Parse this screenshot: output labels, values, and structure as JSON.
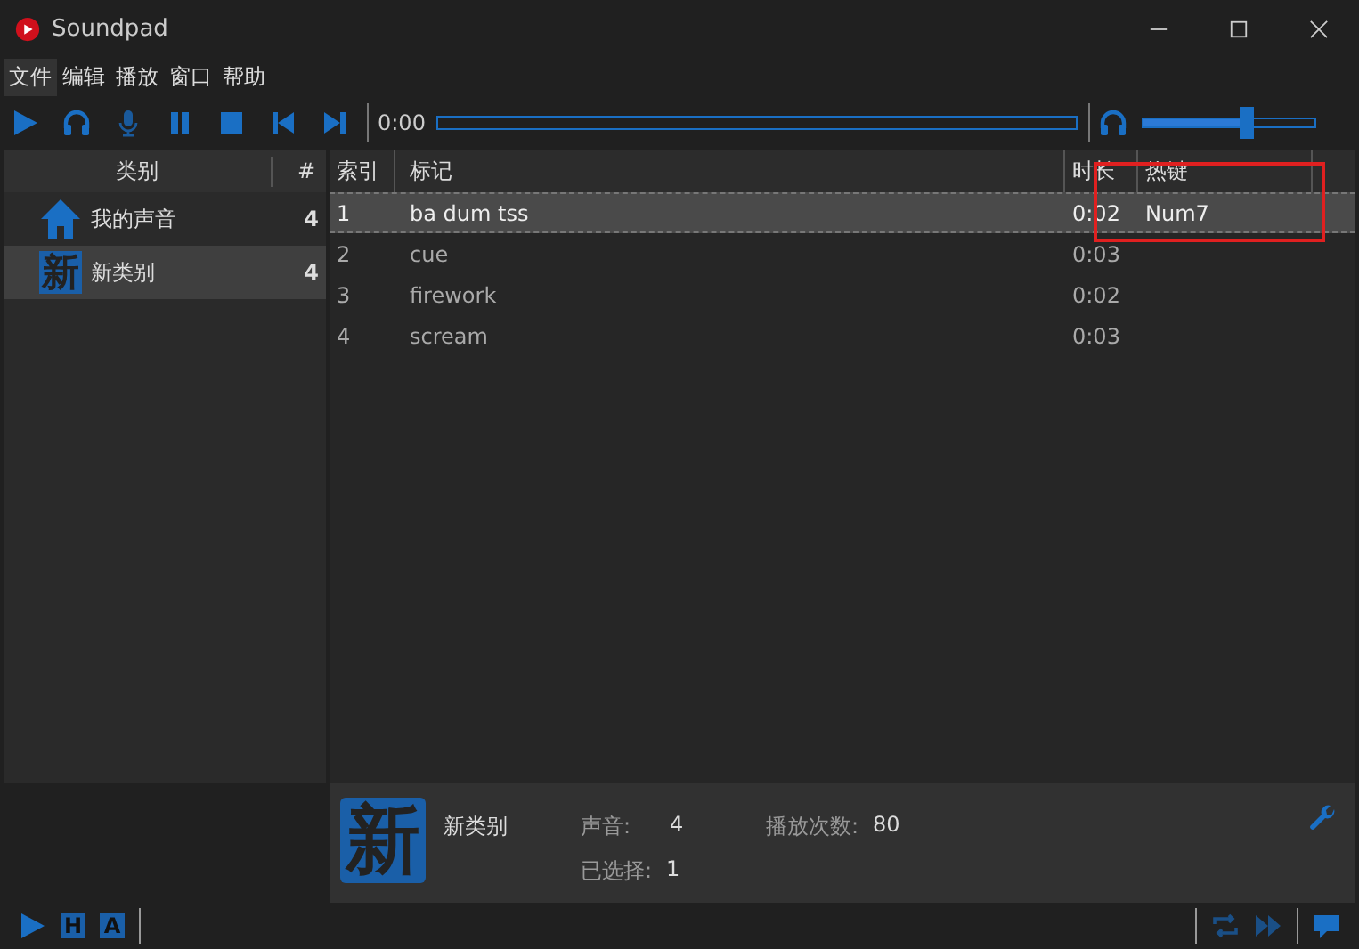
{
  "window": {
    "title": "Soundpad"
  },
  "menu": [
    {
      "label": "文件",
      "selected": true
    },
    {
      "label": "编辑",
      "selected": false
    },
    {
      "label": "播放",
      "selected": false
    },
    {
      "label": "窗口",
      "selected": false
    },
    {
      "label": "帮助",
      "selected": false
    }
  ],
  "toolbar": {
    "time": "0:00",
    "progress": {
      "level": 0
    },
    "volume": {
      "level": 0.6
    }
  },
  "categories": {
    "columns": [
      "类别",
      "#"
    ],
    "items": [
      {
        "kind": "home",
        "name": "我的声音",
        "count": "4",
        "selected": false
      },
      {
        "kind": "glyph",
        "glyph": "新",
        "name": "新类别",
        "count": "4",
        "selected": true
      }
    ]
  },
  "table": {
    "columns": [
      "索引",
      "标记",
      "时长",
      "热键"
    ],
    "rows": [
      {
        "cells": [
          "1",
          "ba dum tss",
          "0:02",
          "Num7"
        ],
        "selected": true
      },
      {
        "cells": [
          "2",
          "cue",
          "0:03"
        ],
        "selected": false
      },
      {
        "cells": [
          "3",
          "firework",
          "0:02"
        ],
        "selected": false
      },
      {
        "cells": [
          "4",
          "scream",
          "0:03"
        ],
        "selected": false
      }
    ]
  },
  "info": {
    "glyph": "新",
    "name": "新类别",
    "stats": [
      {
        "label": "声音:",
        "value": "4"
      },
      {
        "label": "播放次数:",
        "value": "80"
      },
      {
        "label": "已选择:",
        "value": "1"
      }
    ]
  },
  "status_bar": {
    "buttons": [
      "H",
      "A"
    ]
  }
}
